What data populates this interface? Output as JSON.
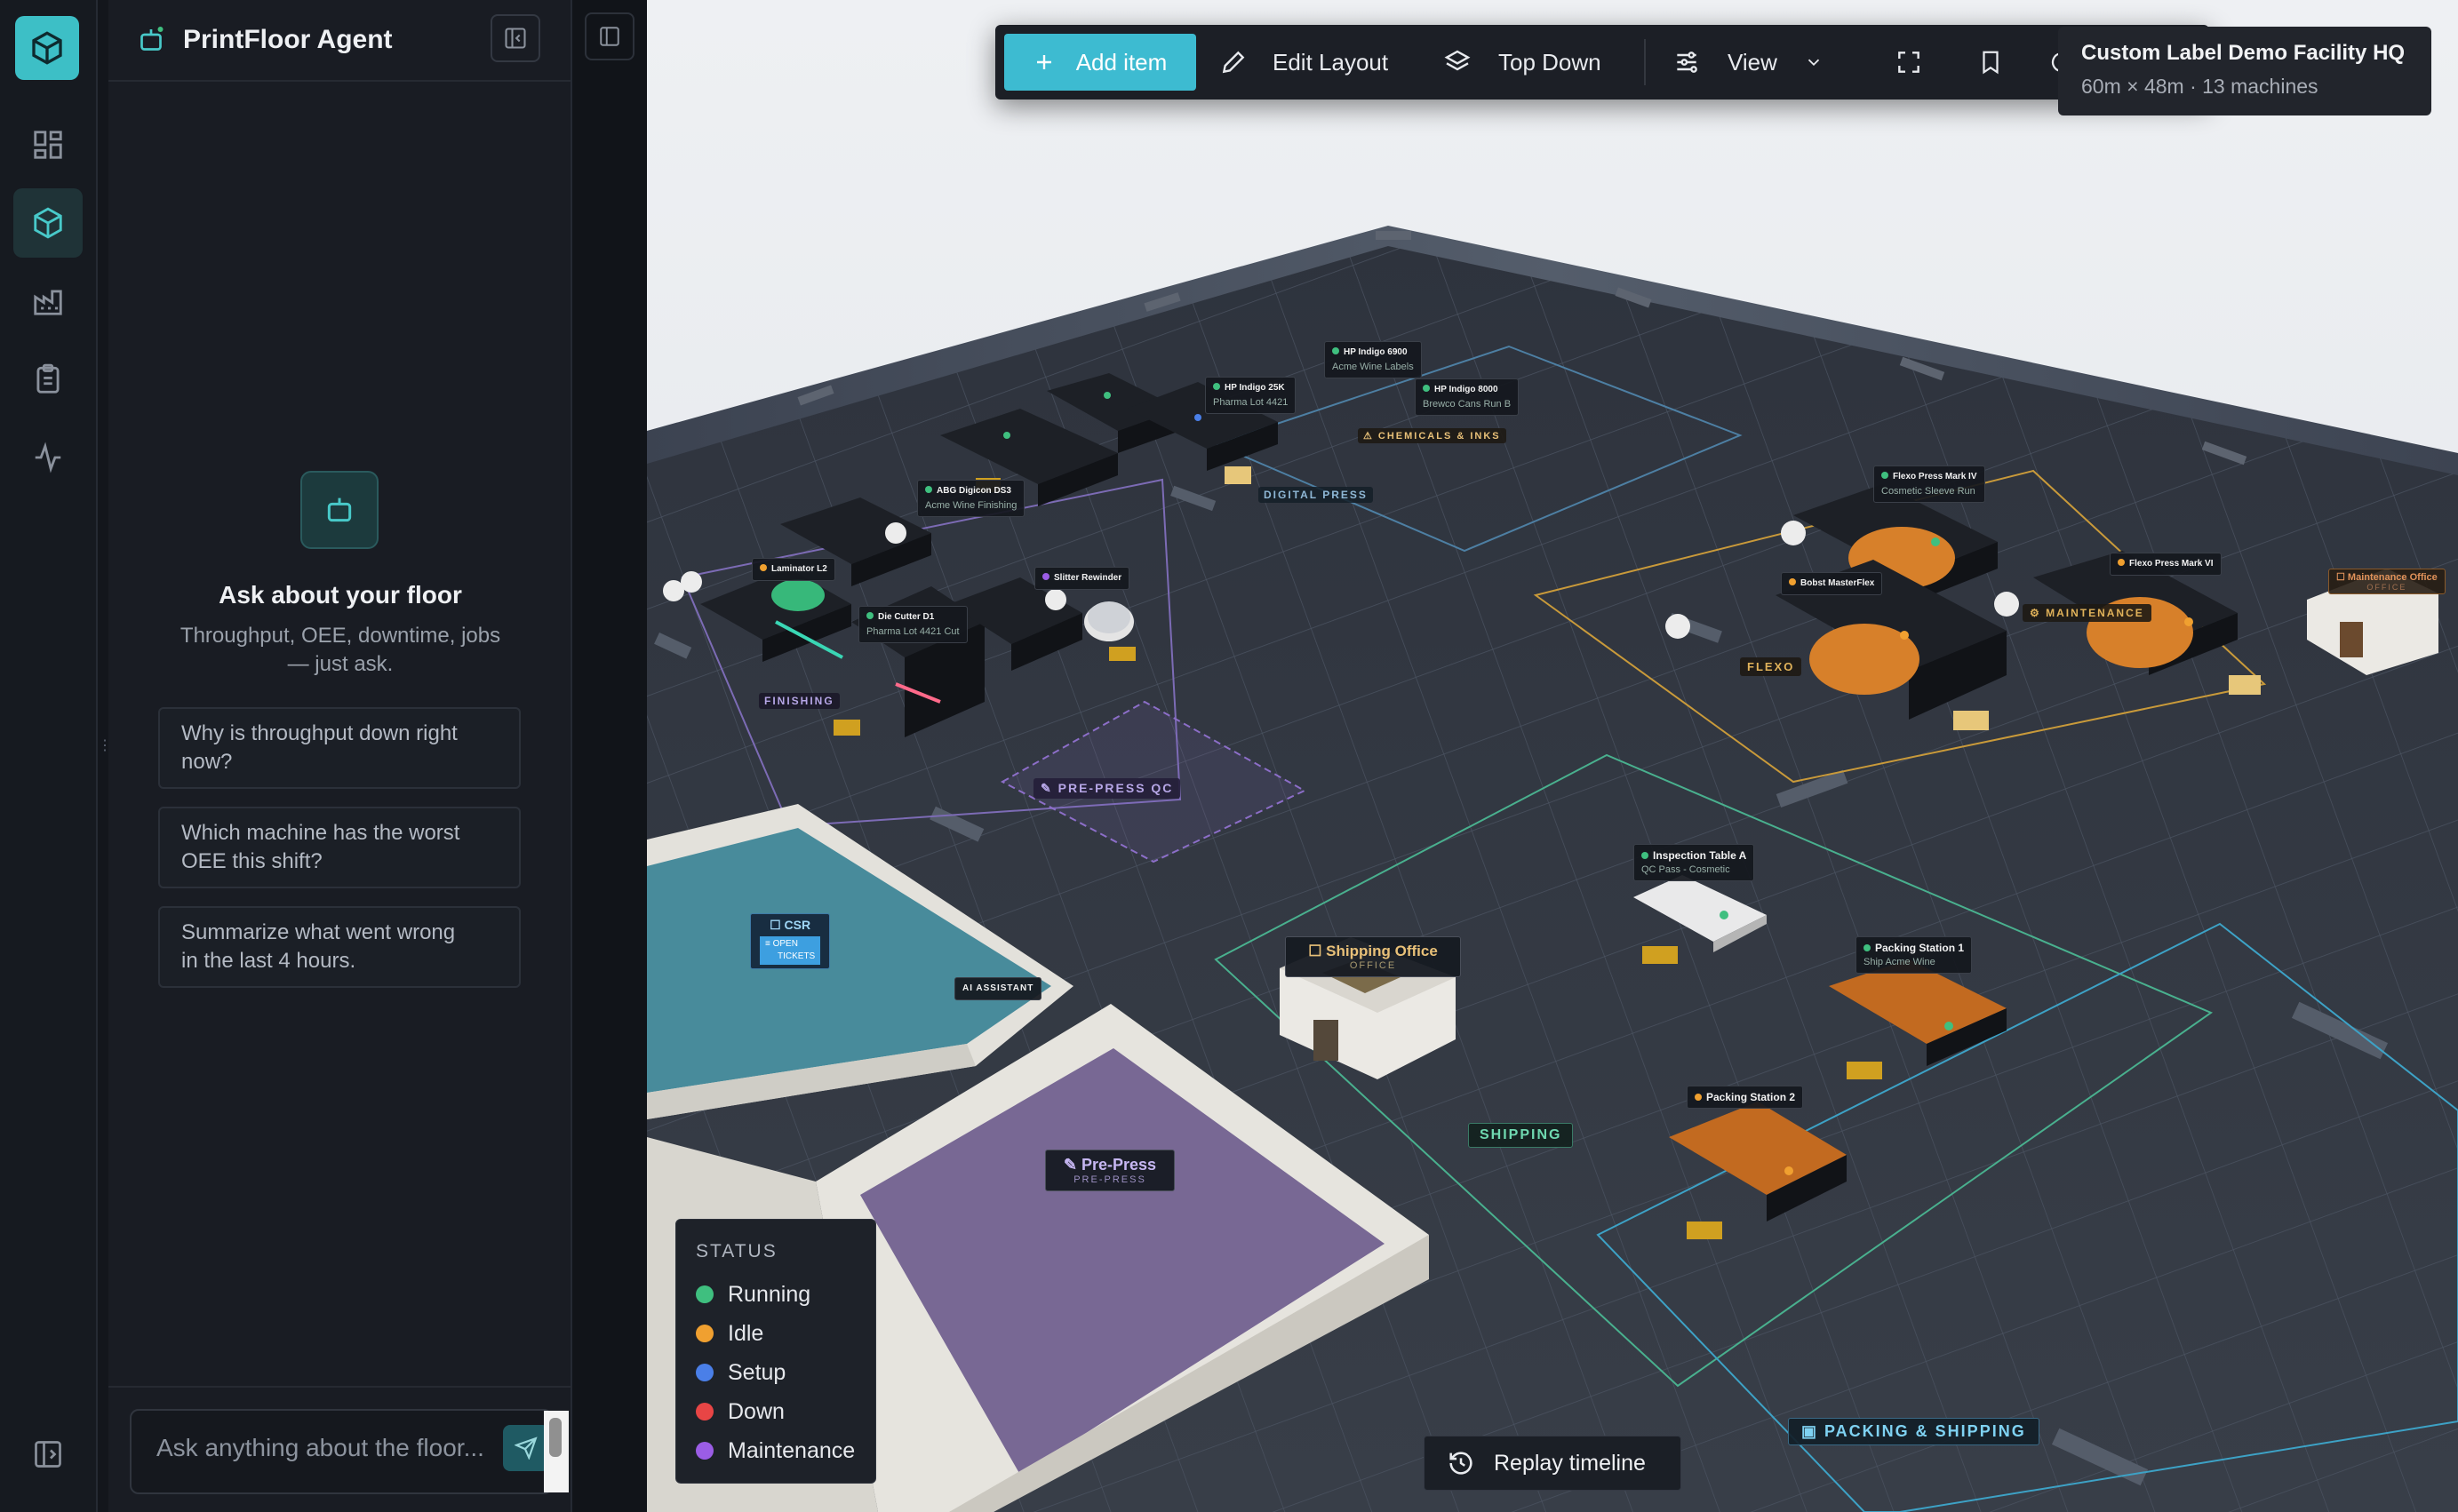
{
  "app": {
    "brand_icon": "cube-icon"
  },
  "rail": {
    "items": [
      {
        "name": "dashboard",
        "icon": "grid-icon"
      },
      {
        "name": "floor-3d",
        "icon": "cube-icon",
        "active": true
      },
      {
        "name": "factory",
        "icon": "factory-icon"
      },
      {
        "name": "jobs",
        "icon": "clipboard-icon"
      },
      {
        "name": "activity",
        "icon": "pulse-icon"
      }
    ],
    "bottom_icon": "panel-toggle-icon"
  },
  "agent": {
    "title": "PrintFloor Agent",
    "empty_title": "Ask about your floor",
    "empty_subtitle_line1": "Throughput, OEE, downtime, jobs",
    "empty_subtitle_line2": "— just ask.",
    "suggestions": [
      {
        "line1": "Why is throughput down right",
        "line2": "now?"
      },
      {
        "line1": "Which machine has the worst",
        "line2": "OEE this shift?"
      },
      {
        "line1": "Summarize what went wrong",
        "line2": "in the last 4 hours."
      }
    ],
    "input_placeholder": "Ask anything about the floor..."
  },
  "toolbar": {
    "add_label": "Add item",
    "edit_label": "Edit Layout",
    "topdown_label": "Top Down",
    "view_label": "View"
  },
  "facility": {
    "name": "Custom Label Demo Facility HQ",
    "meta": "60m × 48m · 13 machines"
  },
  "legend": {
    "title": "STATUS",
    "items": [
      {
        "label": "Running",
        "color": "#3fbf7f"
      },
      {
        "label": "Idle",
        "color": "#f0a030"
      },
      {
        "label": "Setup",
        "color": "#4a7fe8"
      },
      {
        "label": "Down",
        "color": "#e84545"
      },
      {
        "label": "Maintenance",
        "color": "#9b5de5"
      }
    ]
  },
  "replay_label": "Replay timeline",
  "zones": {
    "digital_press": "DIGITAL PRESS",
    "chemicals": "⚠ CHEMICALS & INKS",
    "finishing": "FINISHING",
    "prepress_qc": "✎ PRE-PRESS QC",
    "flexo": "FLEXO",
    "maintenance": "⚙ MAINTENANCE",
    "shipping": "SHIPPING",
    "packing": "▣ PACKING & SHIPPING"
  },
  "rooms": {
    "shipping_office": {
      "title": "☐ Shipping Office",
      "sub": "OFFICE"
    },
    "prepress": {
      "title": "✎ Pre-Press",
      "sub": "PRE-PRESS"
    },
    "csr": {
      "title": "☐ CSR",
      "sub1": "≡ OPEN",
      "sub2": "TICKETS"
    },
    "ai_assistant": "AI ASSISTANT",
    "maintenance_office": {
      "title": "☐ Maintenance Office",
      "sub": "OFFICE"
    }
  },
  "machines": {
    "indigo25k": {
      "name": "HP Indigo 25K",
      "sub": "Pharma Lot 4421"
    },
    "indigo6900": {
      "name": "HP Indigo 6900",
      "sub": "Acme Wine Labels"
    },
    "indigo8000": {
      "name": "HP Indigo 8000",
      "sub": "Brewco Cans Run B"
    },
    "abg": {
      "name": "ABG Digicon DS3",
      "sub": "Acme Wine Finishing"
    },
    "laminator": {
      "name": "Laminator L2"
    },
    "slitter": {
      "name": "Slitter Rewinder"
    },
    "diecutter": {
      "name": "Die Cutter D1",
      "sub": "Pharma Lot 4421 Cut"
    },
    "flexo4": {
      "name": "Flexo Press Mark IV",
      "sub": "Cosmetic Sleeve Run"
    },
    "bobst": {
      "name": "Bobst MasterFlex"
    },
    "flexo6": {
      "name": "Flexo Press Mark VI"
    },
    "inspection": {
      "name": "Inspection Table A",
      "sub": "QC Pass - Cosmetic"
    },
    "packing1": {
      "name": "Packing Station 1",
      "sub": "Ship Acme Wine"
    },
    "packing2": {
      "name": "Packing Station 2"
    }
  }
}
